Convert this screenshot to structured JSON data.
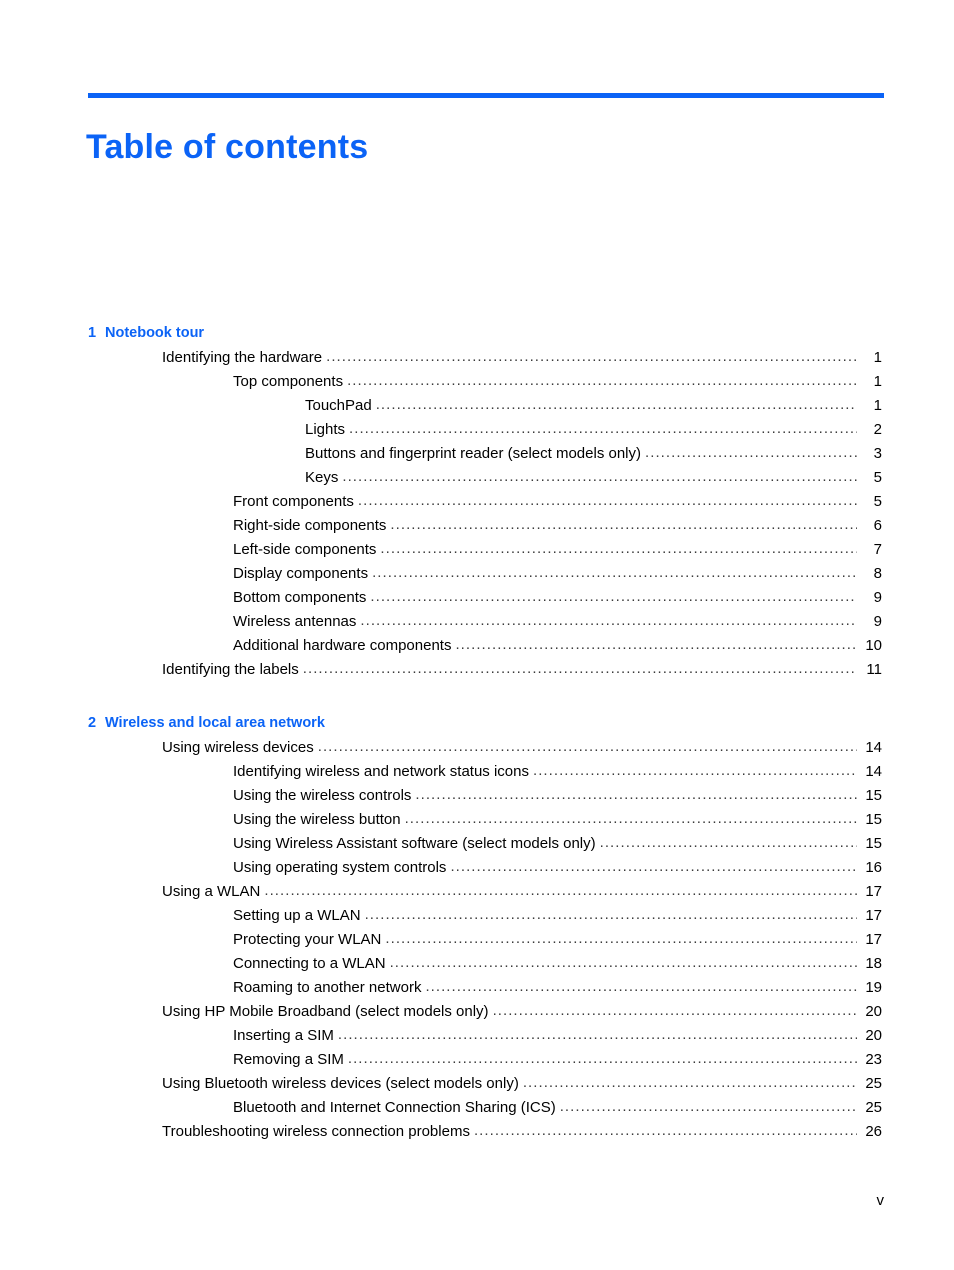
{
  "document": {
    "title": "Table of contents",
    "accent_color": "#0b63f6",
    "text_color": "#000000",
    "folio": "v"
  },
  "chapters": [
    {
      "number": "1",
      "title": "Notebook tour",
      "entries": [
        {
          "label": "Identifying the hardware",
          "page": "1",
          "level": 1
        },
        {
          "label": "Top components",
          "page": "1",
          "level": 2
        },
        {
          "label": "TouchPad",
          "page": "1",
          "level": 3
        },
        {
          "label": "Lights",
          "page": "2",
          "level": 3
        },
        {
          "label": "Buttons and fingerprint reader (select models only)",
          "page": "3",
          "level": 3
        },
        {
          "label": "Keys",
          "page": "5",
          "level": 3
        },
        {
          "label": "Front components",
          "page": "5",
          "level": 2
        },
        {
          "label": "Right-side components",
          "page": "6",
          "level": 2
        },
        {
          "label": "Left-side components",
          "page": "7",
          "level": 2
        },
        {
          "label": "Display components",
          "page": "8",
          "level": 2
        },
        {
          "label": "Bottom components",
          "page": "9",
          "level": 2
        },
        {
          "label": "Wireless antennas",
          "page": "9",
          "level": 2
        },
        {
          "label": "Additional hardware components",
          "page": "10",
          "level": 2
        },
        {
          "label": "Identifying the labels",
          "page": "11",
          "level": 1
        }
      ]
    },
    {
      "number": "2",
      "title": "Wireless and local area network",
      "entries": [
        {
          "label": "Using wireless devices",
          "page": "14",
          "level": 1
        },
        {
          "label": "Identifying wireless and network status icons",
          "page": "14",
          "level": 2
        },
        {
          "label": "Using the wireless controls",
          "page": "15",
          "level": 2
        },
        {
          "label": "Using the wireless button",
          "page": "15",
          "level": 2
        },
        {
          "label": "Using Wireless Assistant software (select models only)",
          "page": "15",
          "level": 2
        },
        {
          "label": "Using operating system controls",
          "page": "16",
          "level": 2
        },
        {
          "label": "Using a WLAN",
          "page": "17",
          "level": 1
        },
        {
          "label": "Setting up a WLAN",
          "page": "17",
          "level": 2
        },
        {
          "label": "Protecting your WLAN",
          "page": "17",
          "level": 2
        },
        {
          "label": "Connecting to a WLAN",
          "page": "18",
          "level": 2
        },
        {
          "label": "Roaming to another network",
          "page": "19",
          "level": 2
        },
        {
          "label": "Using HP Mobile Broadband (select models only)",
          "page": "20",
          "level": 1
        },
        {
          "label": "Inserting a SIM",
          "page": "20",
          "level": 2
        },
        {
          "label": "Removing a SIM",
          "page": "23",
          "level": 2
        },
        {
          "label": "Using Bluetooth wireless devices (select models only)",
          "page": "25",
          "level": 1
        },
        {
          "label": "Bluetooth and Internet Connection Sharing (ICS)",
          "page": "25",
          "level": 2
        },
        {
          "label": "Troubleshooting wireless connection problems",
          "page": "26",
          "level": 1
        }
      ]
    }
  ]
}
